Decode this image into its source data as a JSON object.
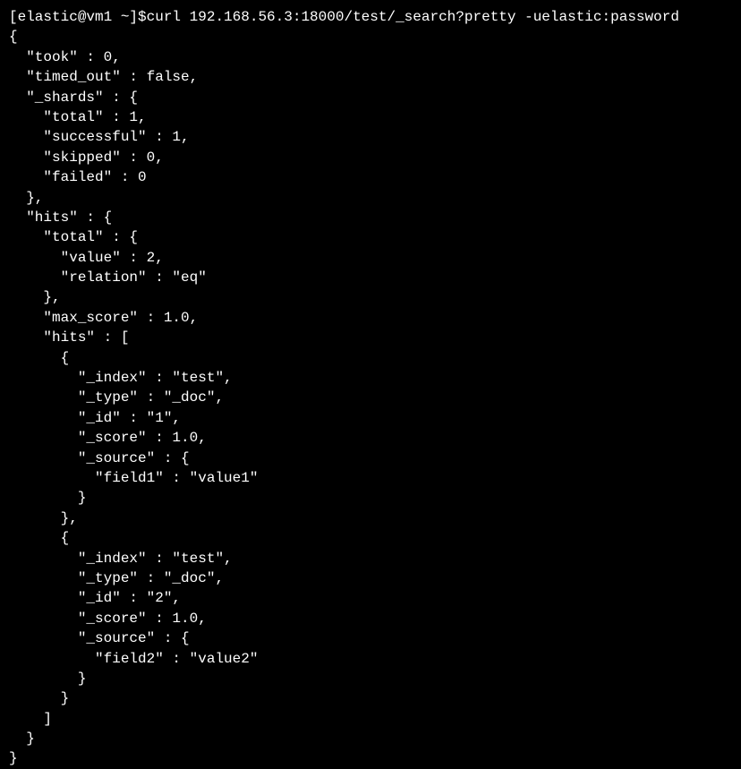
{
  "prompt": {
    "user_host": "[elastic@vm1 ~]$ ",
    "command": "curl 192.168.56.3:18000/test/_search?pretty -uelastic:password"
  },
  "output": "{\n  \"took\" : 0,\n  \"timed_out\" : false,\n  \"_shards\" : {\n    \"total\" : 1,\n    \"successful\" : 1,\n    \"skipped\" : 0,\n    \"failed\" : 0\n  },\n  \"hits\" : {\n    \"total\" : {\n      \"value\" : 2,\n      \"relation\" : \"eq\"\n    },\n    \"max_score\" : 1.0,\n    \"hits\" : [\n      {\n        \"_index\" : \"test\",\n        \"_type\" : \"_doc\",\n        \"_id\" : \"1\",\n        \"_score\" : 1.0,\n        \"_source\" : {\n          \"field1\" : \"value1\"\n        }\n      },\n      {\n        \"_index\" : \"test\",\n        \"_type\" : \"_doc\",\n        \"_id\" : \"2\",\n        \"_score\" : 1.0,\n        \"_source\" : {\n          \"field2\" : \"value2\"\n        }\n      }\n    ]\n  }\n}"
}
